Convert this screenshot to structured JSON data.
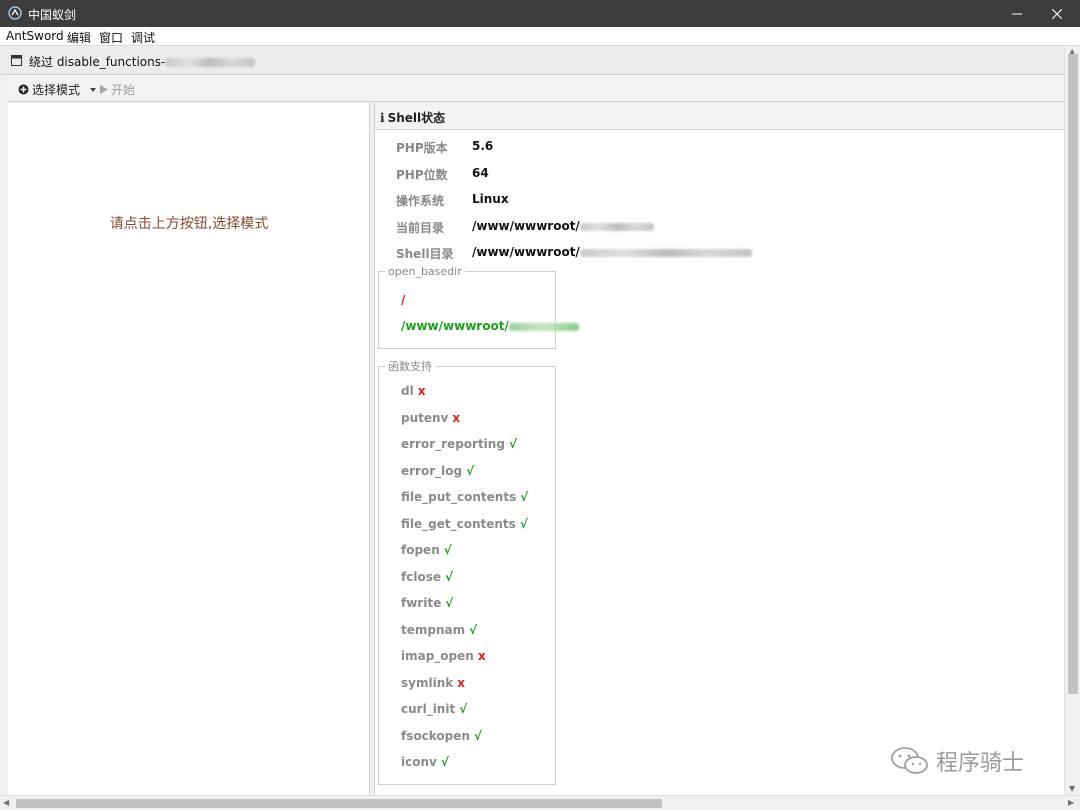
{
  "window": {
    "title": "中国蚁剑"
  },
  "menu": [
    "AntSword",
    "编辑",
    "窗口",
    "调试"
  ],
  "tab": {
    "title": "绕过 disable_functions-"
  },
  "toolbar": {
    "select_mode": "选择模式",
    "start": "开始"
  },
  "left": {
    "hint": "请点击上方按钮,选择模式"
  },
  "shell_status": {
    "header": "Shell状态",
    "rows": [
      {
        "key": "PHP版本",
        "value": "5.6"
      },
      {
        "key": "PHP位数",
        "value": "64"
      },
      {
        "key": "操作系统",
        "value": "Linux"
      },
      {
        "key": "当前目录",
        "value": "/www/wwwroot/"
      },
      {
        "key": "Shell目录",
        "value": "/www/wwwroot/"
      }
    ]
  },
  "open_basedir": {
    "legend": "open_basedir",
    "items": [
      {
        "text": "/",
        "color": "#e02020"
      },
      {
        "text": "/www/wwwroot/",
        "color": "#1aa01a"
      }
    ]
  },
  "functions": {
    "legend": "函数支持",
    "items": [
      {
        "name": "dl",
        "mark": "x"
      },
      {
        "name": "putenv",
        "mark": "x"
      },
      {
        "name": "error_reporting",
        "mark": "√"
      },
      {
        "name": "error_log",
        "mark": "√"
      },
      {
        "name": "file_put_contents",
        "mark": "√"
      },
      {
        "name": "file_get_contents",
        "mark": "√"
      },
      {
        "name": "fopen",
        "mark": "√"
      },
      {
        "name": "fclose",
        "mark": "√"
      },
      {
        "name": "fwrite",
        "mark": "√"
      },
      {
        "name": "tempnam",
        "mark": "√"
      },
      {
        "name": "imap_open",
        "mark": "x"
      },
      {
        "name": "symlink",
        "mark": "x"
      },
      {
        "name": "curl_init",
        "mark": "√"
      },
      {
        "name": "fsockopen",
        "mark": "√"
      },
      {
        "name": "iconv",
        "mark": "√"
      }
    ]
  },
  "watermark": {
    "text": "程序骑士"
  },
  "colors": {
    "titlebar": "#3c3c3c",
    "hint": "#8b4a2c",
    "supported": "#1aa01a",
    "unsupported": "#e02020"
  }
}
